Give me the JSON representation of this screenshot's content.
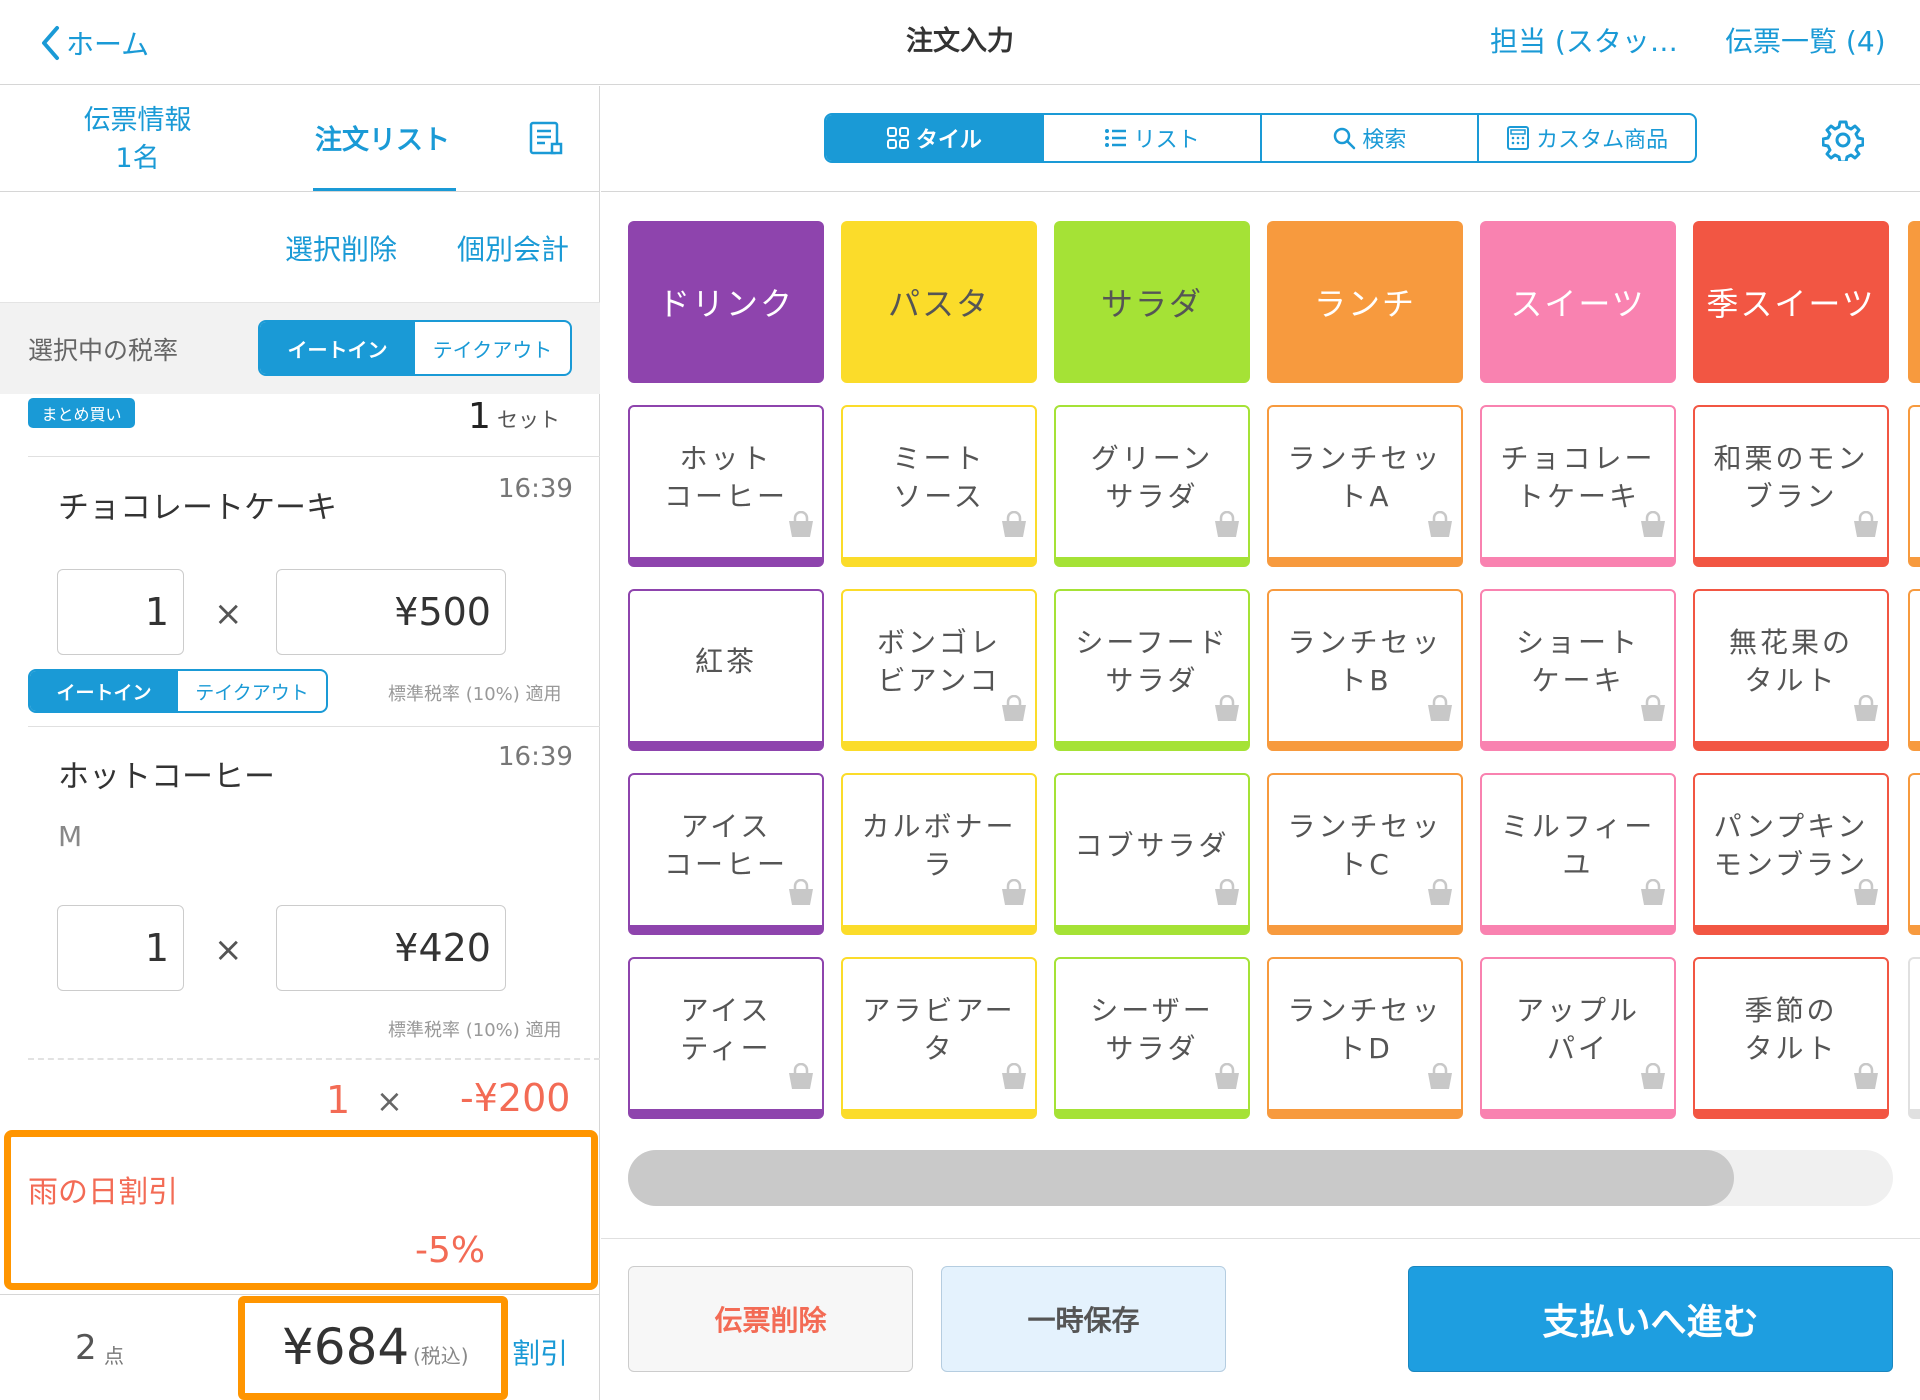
{
  "header": {
    "back_label": "ホーム",
    "title": "注文入力",
    "staff_label": "担当 (スタッ…",
    "slips_label": "伝票一覧 (4)"
  },
  "left": {
    "tab_info_line1": "伝票情報",
    "tab_info_line2": "1名",
    "tab_order": "注文リスト",
    "delete_selected": "選択削除",
    "individual_checkout": "個別会計",
    "tax_label": "選択中の税率",
    "eat_in": "イートイン",
    "take_out": "テイクアウト",
    "bulk_badge": "まとめ買い",
    "set_count": "1",
    "set_unit": "セット",
    "items": [
      {
        "name": "チョコレートケーキ",
        "time": "16:39",
        "qty": "1",
        "times": "×",
        "price": "¥500",
        "tax_note": "標準税率 (10%) 適用",
        "eat_in": "イートイン",
        "take_out": "テイクアウト"
      },
      {
        "name": "ホットコーヒー",
        "time": "16:39",
        "option": "M",
        "qty": "1",
        "times": "×",
        "price": "¥420",
        "tax_note": "標準税率 (10%) 適用"
      }
    ],
    "discount_line": {
      "qty": "1",
      "times": "×",
      "amount": "-¥200"
    },
    "rain_discount": {
      "name": "雨の日割引",
      "percent": "-5%"
    },
    "footer": {
      "count": "2",
      "count_unit": "点",
      "total": "¥684",
      "total_tax": "(税込)",
      "discount_link": "割引"
    }
  },
  "view_tabs": [
    "タイル",
    "リスト",
    "検索",
    "カスタム商品"
  ],
  "categories": [
    {
      "label": "ドリンク",
      "color": "#8e44ad"
    },
    {
      "label": "パスタ",
      "color": "#fbdc2a",
      "text_color": "#555555"
    },
    {
      "label": "サラダ",
      "color": "#a5e236",
      "text_color": "#555555"
    },
    {
      "label": "ランチ",
      "color": "#f79a3e"
    },
    {
      "label": "スイーツ",
      "color": "#f982b0"
    },
    {
      "label": "季スイーツ",
      "color": "#f25643"
    }
  ],
  "products": [
    [
      "ホット\nコーヒー",
      "紅茶",
      "アイス\nコーヒー",
      "アイス\nティー"
    ],
    [
      "ミート\nソース",
      "ボンゴレ\nビアンコ",
      "カルボナー\nラ",
      "アラビアー\nタ"
    ],
    [
      "グリーン\nサラダ",
      "シーフード\nサラダ",
      "コブサラダ",
      "シーザー\nサラダ"
    ],
    [
      "ランチセッ\nトA",
      "ランチセッ\nトB",
      "ランチセッ\nトC",
      "ランチセッ\nトD"
    ],
    [
      "チョコレー\nトケーキ",
      "ショート\nケーキ",
      "ミルフィー\nユ",
      "アップル\nパイ"
    ],
    [
      "和栗のモン\nブラン",
      "無花果の\nタルト",
      "パンプキン\nモンブラン",
      "季節の\nタルト"
    ]
  ],
  "buttons": {
    "delete_slip": "伝票削除",
    "hold": "一時保存",
    "pay": "支払いへ進む"
  },
  "colors": {
    "accent": "#1a9ad6",
    "highlight": "#ff9500",
    "discount": "#f36b55"
  }
}
